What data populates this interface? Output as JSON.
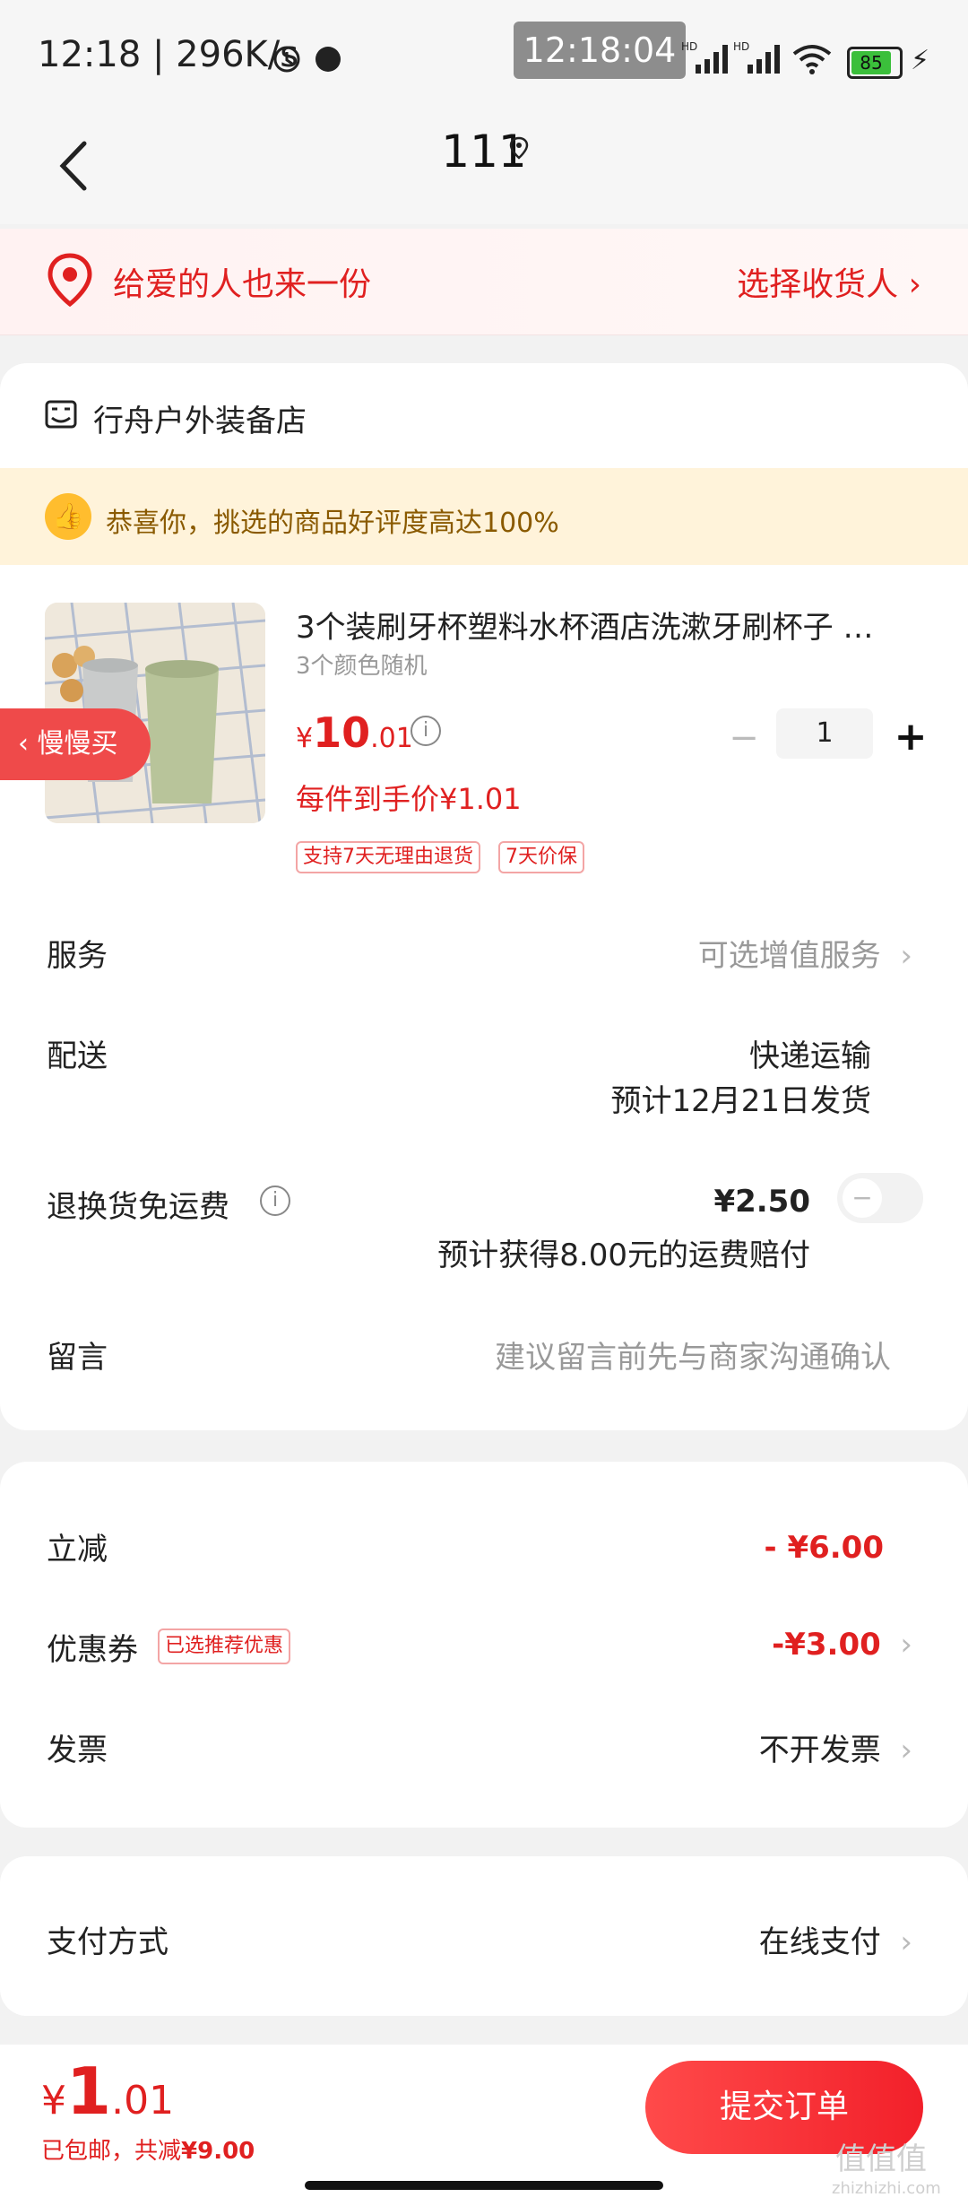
{
  "status_bar": {
    "time_left": "12:18 | 296K/s",
    "time_overlay": "12:18:04",
    "battery": "85",
    "hd_labels": [
      "HD",
      "HD"
    ]
  },
  "header": {
    "title": "111"
  },
  "gift_banner": {
    "text": "给爱的人也来一份",
    "action": "选择收货人"
  },
  "shop": {
    "name": "行舟户外装备店"
  },
  "promo": {
    "text": "恭喜你，挑选的商品好评度高达100%"
  },
  "product": {
    "title": "3个装刷牙杯塑料水杯酒店洗漱牙刷杯子 …",
    "subtitle": "3个颜色随机",
    "price_symbol": "¥",
    "price_int": "10",
    "price_dec": ".01",
    "quantity": "1",
    "unit_price": "每件到手价¥1.01",
    "tags": [
      "支持7天无理由退货",
      "7天价保"
    ],
    "slow_buy": "慢慢买"
  },
  "rows": {
    "service_label": "服务",
    "service_value": "可选增值服务",
    "delivery_label": "配送",
    "delivery_value": "快递运输",
    "delivery_eta": "预计12月21日发货",
    "return_label": "退换货免运费",
    "return_price": "¥2.50",
    "return_note": "预计获得8.00元的运费赔付",
    "message_label": "留言",
    "message_placeholder": "建议留言前先与商家沟通确认"
  },
  "discounts": {
    "instant_label": "立减",
    "instant_value": "- ¥6.00",
    "coupon_label": "优惠券",
    "coupon_badge": "已选推荐优惠",
    "coupon_value": "-¥3.00",
    "invoice_label": "发票",
    "invoice_value": "不开发票"
  },
  "payment": {
    "label": "支付方式",
    "value": "在线支付"
  },
  "bottom_bar": {
    "total_symbol": "¥",
    "total_int": "1",
    "total_dec": ".01",
    "sub_prefix": "已包邮，共减",
    "sub_amount": "¥9.00",
    "submit": "提交订单"
  },
  "watermark": {
    "main": "值值值",
    "sub": "zhizhizhi.com"
  },
  "colors": {
    "accent": "#e02020",
    "promo_bg": "#fff3da",
    "page_bg": "#f2f2f2"
  }
}
